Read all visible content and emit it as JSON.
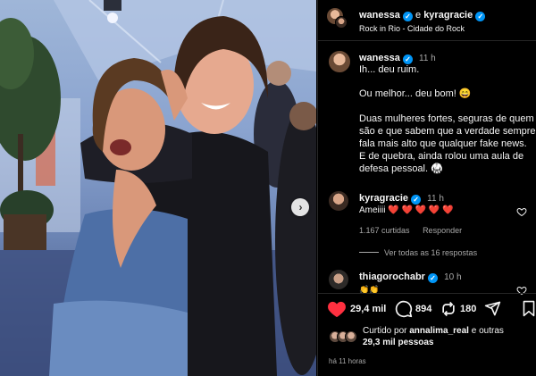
{
  "post": {
    "header": {
      "user1": "wanessa",
      "joiner": "e",
      "user2": "kyragracie",
      "location": "Rock in Rio - Cidade do Rock"
    },
    "caption": {
      "username": "wanessa",
      "time": "11 h",
      "line1": "Ih... deu ruim.",
      "line2": "Ou melhor... deu bom! 😄",
      "line3": "Duas mulheres fortes, seguras de quem",
      "line4": "são e que sabem que a verdade sempre",
      "line5": "fala mais alto que qualquer fake news.",
      "line6": "E de quebra, ainda rolou uma aula de",
      "line7": "defesa pessoal. 🥋"
    },
    "comments": [
      {
        "username": "kyragracie",
        "time": "11 h",
        "text": "Ameiiii ❤️ ❤️ ❤️ ❤️ ❤️",
        "likes": "1.167 curtidas",
        "reply": "Responder",
        "view_replies": "Ver todas as 16 respostas"
      },
      {
        "username": "thiagorochabr",
        "time": "10 h",
        "text": "👏👏"
      }
    ],
    "actions": {
      "likes": "29,4 mil",
      "comments": "894",
      "reposts": "180"
    },
    "liked_by": {
      "prefix": "Curtido por",
      "user": "annalima_real",
      "middle": "e outras",
      "count": "29,3 mil pessoas"
    },
    "timestamp": "há 11 horas"
  },
  "colors": {
    "verified": "#0095f6",
    "like": "#ff3040",
    "muted": "#a8a8a8"
  },
  "icons": [
    "verified-icon",
    "more-icon",
    "heart-icon",
    "comment-icon",
    "repost-icon",
    "share-icon",
    "save-icon",
    "carousel-next-icon"
  ]
}
